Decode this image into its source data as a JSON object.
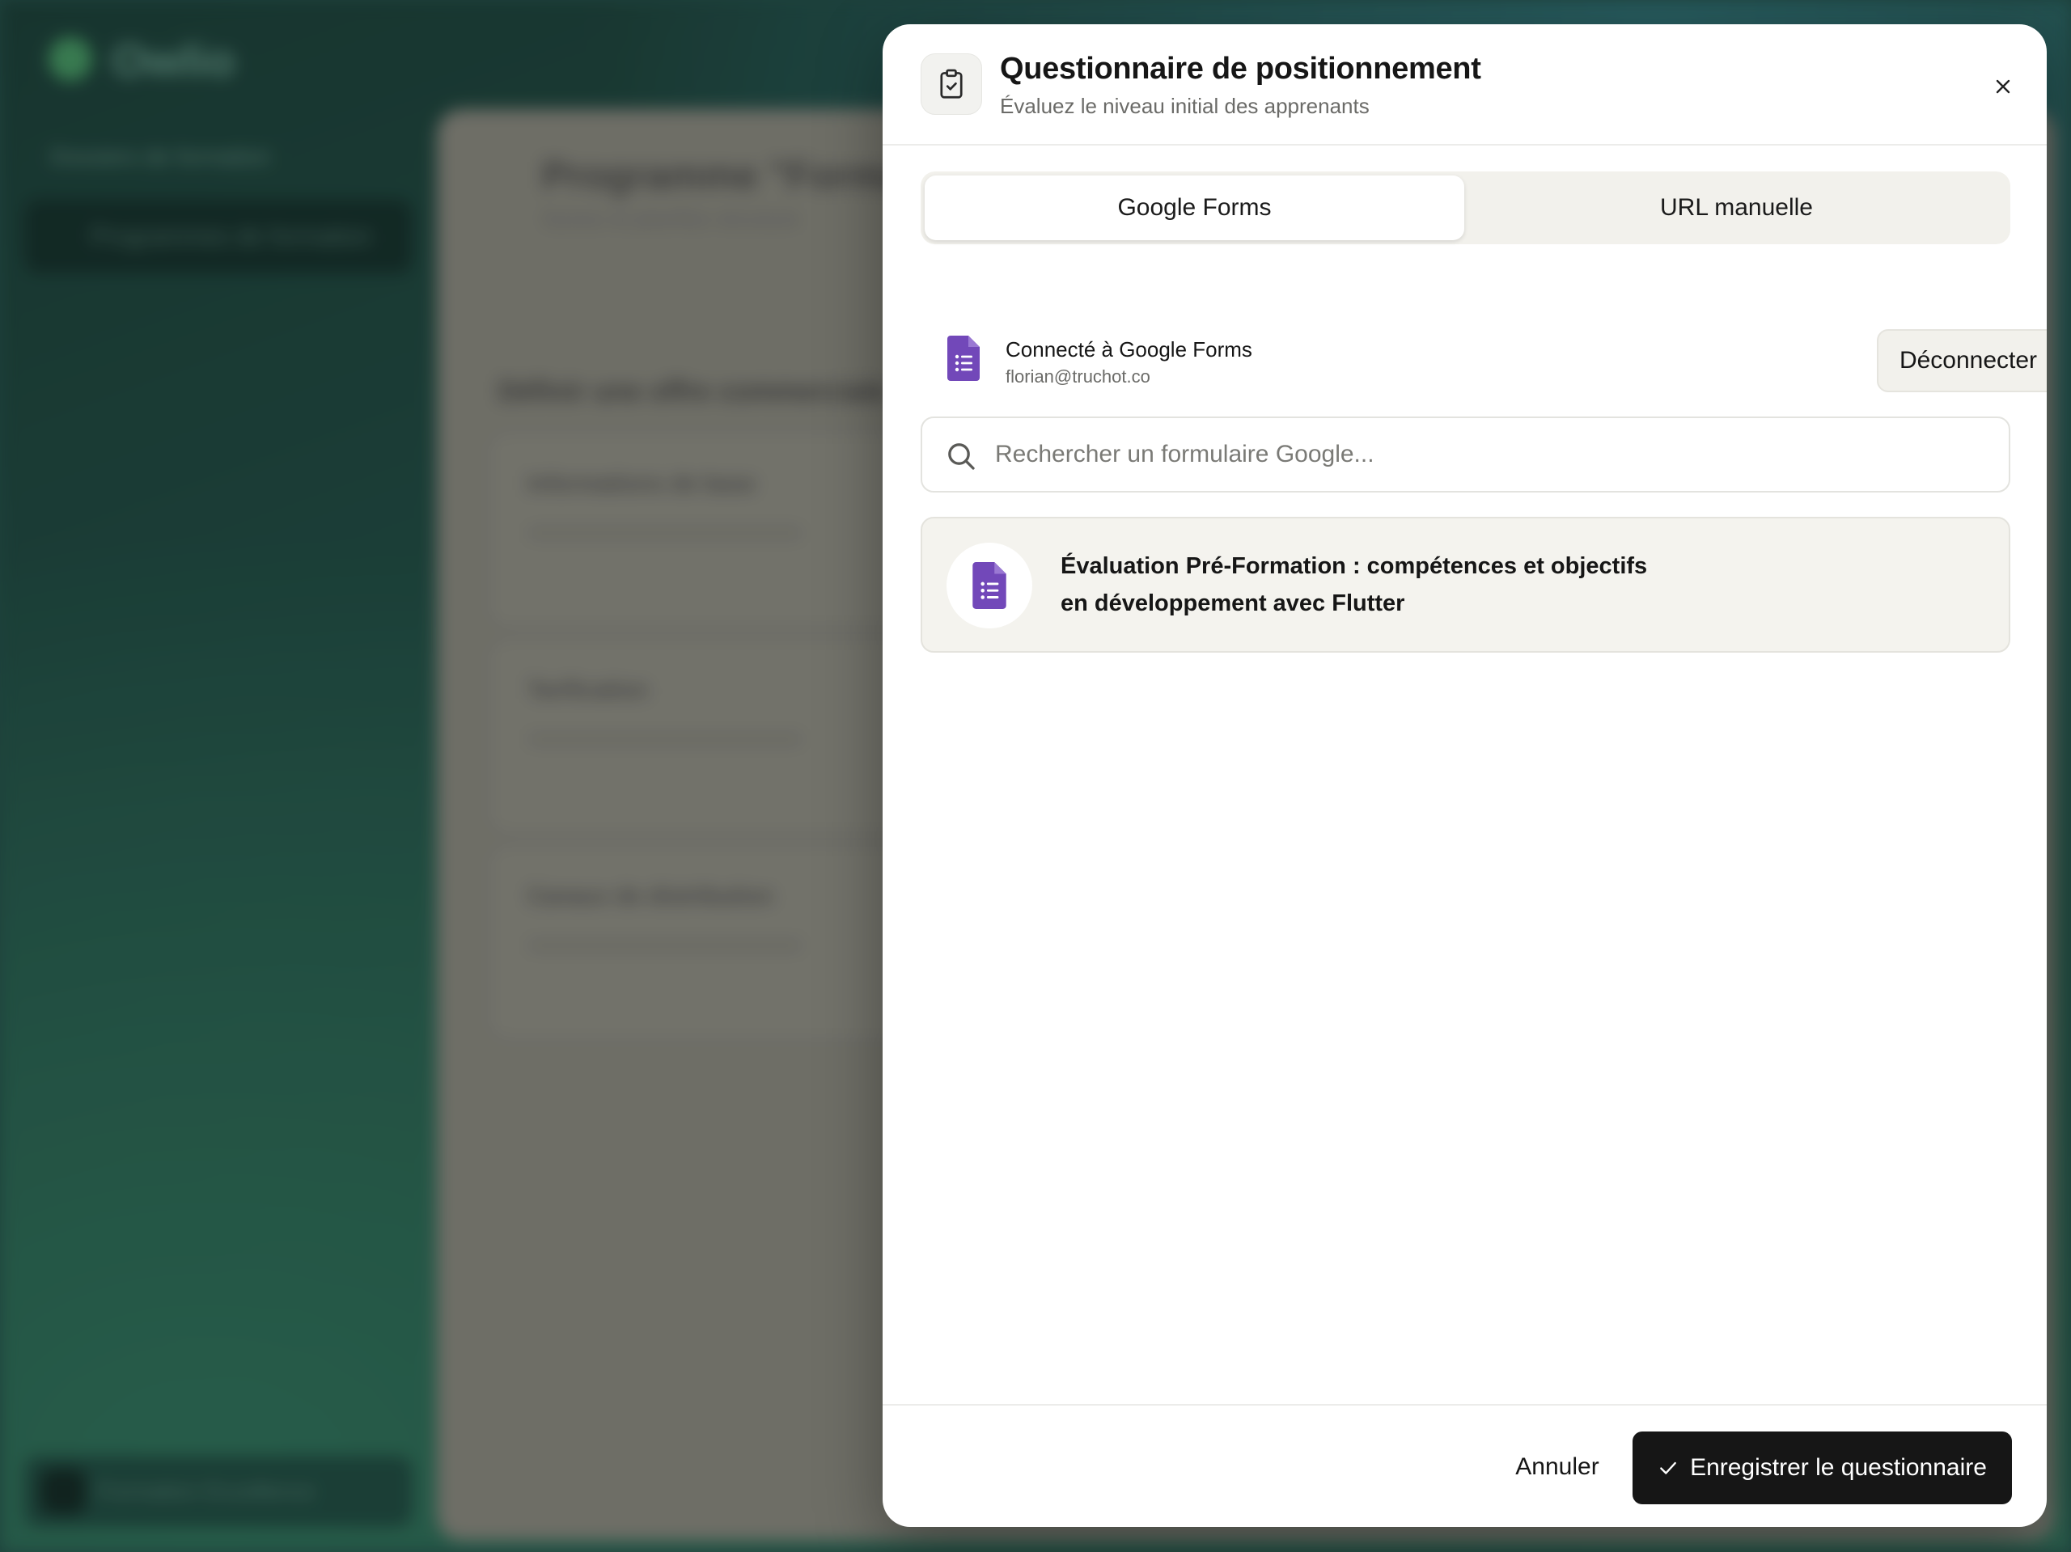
{
  "background": {
    "app_name": "Owlio",
    "nav_item_1": "Dossiers de formation",
    "nav_item_2": "Programmes de formation",
    "page_title": "Programme \"Forma",
    "page_subtitle": "Suivez et planifiez structure",
    "section_title": "Définir une offre commerciale",
    "card_1": "Informations de base",
    "card_2": "Tarification",
    "card_3": "Canaux de distribution",
    "user_name": "Formation Excellence"
  },
  "modal": {
    "title": "Questionnaire de positionnement",
    "subtitle": "Évaluez le niveau initial des apprenants",
    "header_icon": "clipboard-check-icon",
    "close_icon": "close-icon"
  },
  "tabs": [
    {
      "label": "Google Forms",
      "active": true
    },
    {
      "label": "URL manuelle",
      "active": false
    }
  ],
  "connection": {
    "title": "Connecté à Google Forms",
    "email": "florian@truchot.co",
    "disconnect_label": "Déconnecter",
    "icon": "google-forms-icon"
  },
  "search": {
    "placeholder": "Rechercher un formulaire Google...",
    "value": ""
  },
  "results": [
    {
      "title": "Évaluation Pré-Formation : compétences et objectifs en développement avec Flutter",
      "icon": "google-forms-icon"
    }
  ],
  "footer": {
    "cancel_label": "Annuler",
    "save_label": "Enregistrer le questionnaire",
    "save_icon": "check-icon"
  },
  "colors": {
    "primary_button": "#161616",
    "google_forms_purple": "#7248b9",
    "tab_background": "#f2f1ec"
  }
}
